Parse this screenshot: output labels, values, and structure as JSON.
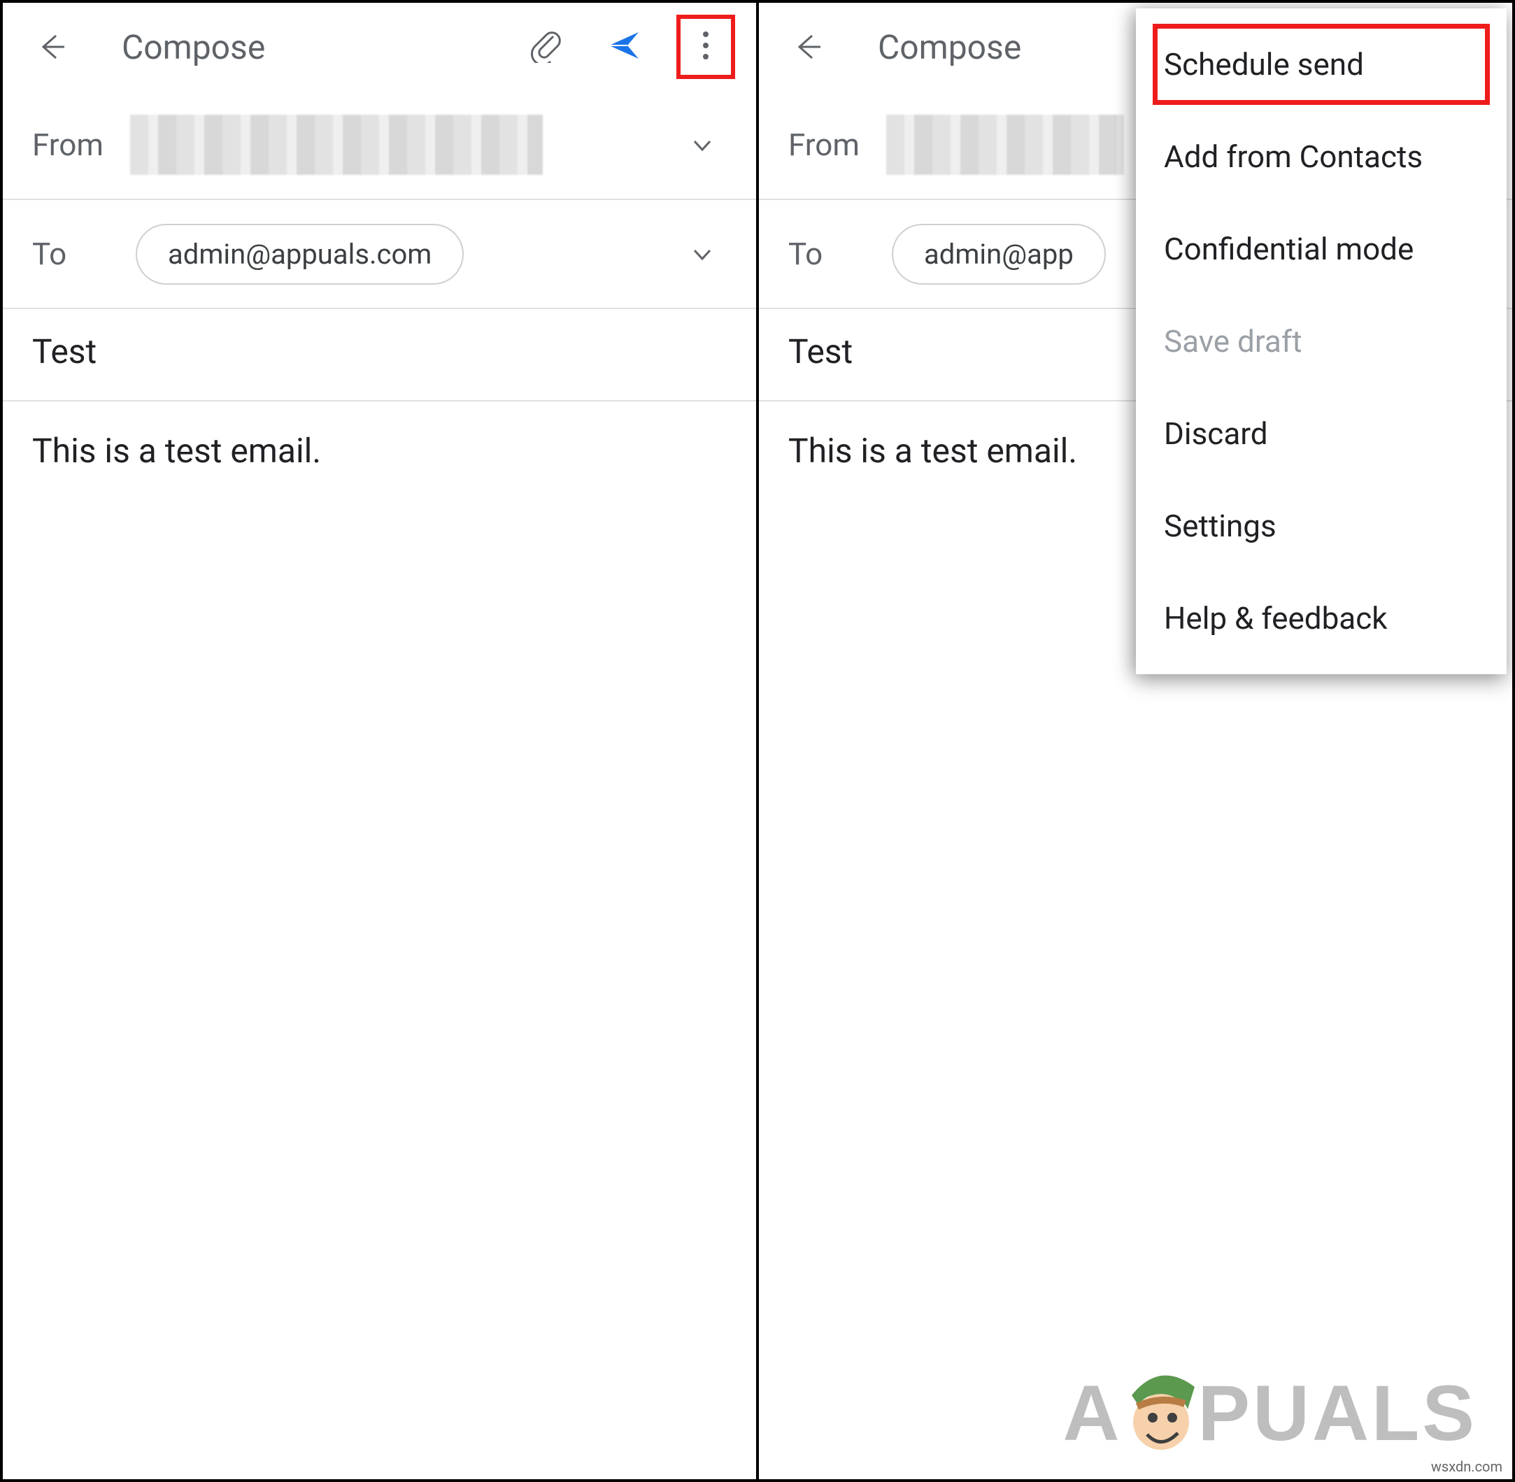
{
  "left": {
    "title": "Compose",
    "from_label": "From",
    "to_label": "To",
    "to_chip": "admin@appuals.com",
    "subject": "Test",
    "body": "This is a test email."
  },
  "right": {
    "title": "Compose",
    "from_label": "From",
    "to_label": "To",
    "to_chip": "admin@app",
    "subject": "Test",
    "body": "This is a test email."
  },
  "menu": {
    "items": [
      {
        "label": "Schedule send",
        "highlight": true
      },
      {
        "label": "Add from Contacts"
      },
      {
        "label": "Confidential mode"
      },
      {
        "label": "Save draft",
        "disabled": true
      },
      {
        "label": "Discard"
      },
      {
        "label": "Settings"
      },
      {
        "label": "Help & feedback"
      }
    ]
  },
  "watermark": {
    "prefix": "A",
    "suffix": "PUALS",
    "attribution": "wsxdn.com"
  },
  "icons": {
    "back": "back-arrow-icon",
    "attach": "paperclip-icon",
    "send": "send-icon",
    "more": "more-vert-icon",
    "chevron": "chevron-down-icon"
  }
}
